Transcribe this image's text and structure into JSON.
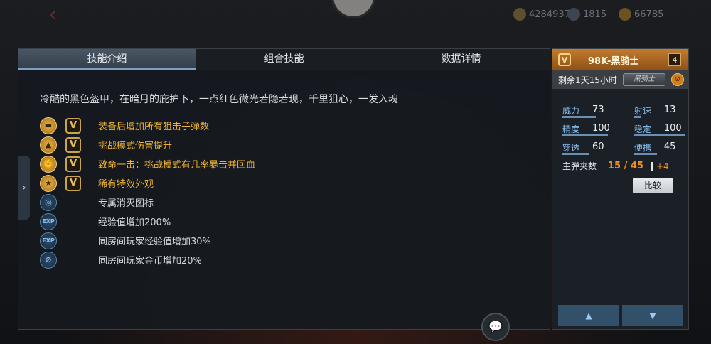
{
  "topbar": {
    "back_icon": "back-arrow-icon",
    "currency": [
      {
        "icon": "coin-icon",
        "value": "4284937"
      },
      {
        "icon": "diamond-icon",
        "value": "1815"
      },
      {
        "icon": "honor-icon",
        "value": "66785"
      }
    ]
  },
  "tabs": [
    "技能介绍",
    "组合技能",
    "数据详情"
  ],
  "active_tab": 0,
  "description": "冷酷的黑色盔甲，在暗月的庇护下，一点红色微光若隐若现，千里狙心，一发入魂",
  "skills": [
    {
      "icon": "pistol-icon",
      "glyph": "▬",
      "style": "gold",
      "vip": true,
      "text": "装备后增加所有狙击子弹数"
    },
    {
      "icon": "warning-icon",
      "glyph": "▲",
      "style": "gold",
      "vip": true,
      "text": "挑战模式伤害提升"
    },
    {
      "icon": "fist-icon",
      "glyph": "✊",
      "style": "gold",
      "vip": true,
      "text": "致命一击：挑战模式有几率暴击并回血"
    },
    {
      "icon": "star-icon",
      "glyph": "★",
      "style": "gold",
      "vip": true,
      "text": "稀有特效外观"
    },
    {
      "icon": "target-icon",
      "glyph": "◎",
      "style": "blue",
      "vip": false,
      "text": "专属消灭图标"
    },
    {
      "icon": "exp-icon",
      "glyph": "EXP",
      "style": "blue",
      "vip": false,
      "text": "经验值增加200%"
    },
    {
      "icon": "exp-icon",
      "glyph": "EXP",
      "style": "blue",
      "vip": false,
      "text": "同房间玩家经验值增加30%"
    },
    {
      "icon": "coin-icon",
      "glyph": "⊘",
      "style": "blue",
      "vip": false,
      "text": "同房间玩家金币增加20%"
    }
  ],
  "vip_badge": "V",
  "weapon": {
    "badge": "V",
    "name": "98K-黑骑士",
    "count": "4",
    "remaining": "剩余1天15小时",
    "rank_tag": "黑骑士",
    "stats": [
      [
        {
          "label": "威力",
          "value": "73",
          "fill": 0.73
        },
        {
          "label": "射速",
          "value": "13",
          "fill": 0.13
        }
      ],
      [
        {
          "label": "精度",
          "value": "100",
          "fill": 1.0
        },
        {
          "label": "稳定",
          "value": "100",
          "fill": 1.0
        }
      ],
      [
        {
          "label": "穿透",
          "value": "60",
          "fill": 0.6
        },
        {
          "label": "便携",
          "value": "45",
          "fill": 0.45
        }
      ]
    ],
    "ammo_label": "主弹夹数",
    "ammo_value": "15 / 45",
    "ammo_bonus": "+4",
    "compare_label": "比较"
  },
  "nav": {
    "up": "▲",
    "down": "▼"
  },
  "chat_glyph": "💬",
  "colors": {
    "accent_gold": "#f0b236",
    "accent_orange": "#f4901e",
    "stat_label": "#8cbff0"
  }
}
